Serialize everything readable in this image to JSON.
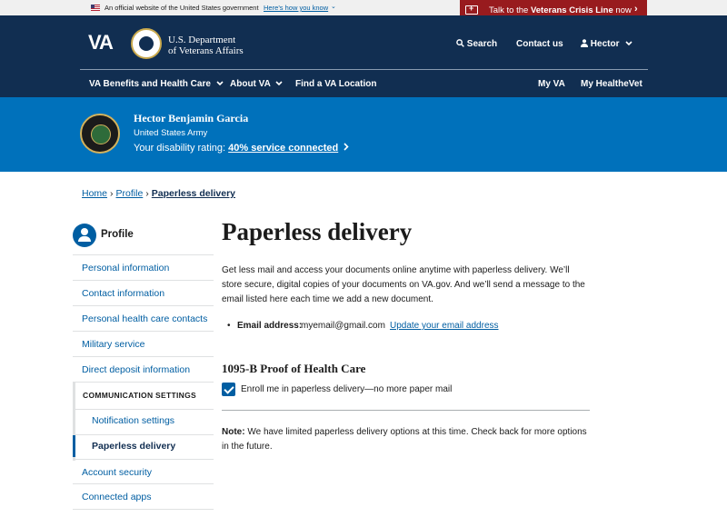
{
  "gov_banner": {
    "text": "An official website of the United States government",
    "link": "Here’s how you know",
    "chevron": "⌄"
  },
  "crisis_line": {
    "prefix": "Talk to the ",
    "bold": "Veterans Crisis Line",
    "suffix": " now",
    "chevron": "›"
  },
  "header": {
    "logo": "VA",
    "dept_line1": "U.S. Department",
    "dept_line2": "of Veterans Affairs",
    "search": "Search",
    "contact": "Contact us",
    "user": "Hector",
    "nav": [
      "VA Benefits and Health Care",
      "About VA",
      "Find a VA Location",
      "My VA",
      "My HealtheVet"
    ]
  },
  "profile_banner": {
    "name": "Hector Benjamin Garcia",
    "branch": "United States Army",
    "rating_label": "Your disability rating: ",
    "rating_link": "40% service connected"
  },
  "breadcrumb": {
    "items": [
      "Home",
      "Profile",
      "Paperless delivery"
    ]
  },
  "sidebar": {
    "title": "Profile",
    "items": [
      "Personal information",
      "Contact information",
      "Personal health care contacts",
      "Military service",
      "Direct deposit information"
    ],
    "group_heading": "COMMUNICATION SETTINGS",
    "group_items": [
      "Notification settings",
      "Paperless delivery"
    ],
    "bottom_items": [
      "Account security",
      "Connected apps"
    ]
  },
  "main": {
    "title": "Paperless delivery",
    "intro": "Get less mail and access your documents online anytime with paperless delivery. We’ll store secure, digital copies of your documents on VA.gov. And we’ll send a message to the email listed here each time we add a new document.",
    "email_label": "Email address:",
    "email_value": "myemail@gmail.com",
    "email_update": "Update your email address",
    "section_heading": "1095-B Proof of Health Care",
    "checkbox_label": "Enroll me in paperless delivery—no more paper mail",
    "checkbox_checked": true,
    "note_label": "Note:",
    "note_text": " We have limited paperless delivery options at this time. Check back for more options in the future."
  },
  "colors": {
    "header_navy": "#112e51",
    "banner_blue": "#0071bb",
    "link_blue": "#005ea2",
    "crisis_red": "#981b1e"
  },
  "icons": [
    "us-flag-icon",
    "crisis-line-icon",
    "va-seal-icon",
    "search-icon",
    "user-icon",
    "army-emblem-icon",
    "profile-icon",
    "checkmark-icon"
  ]
}
